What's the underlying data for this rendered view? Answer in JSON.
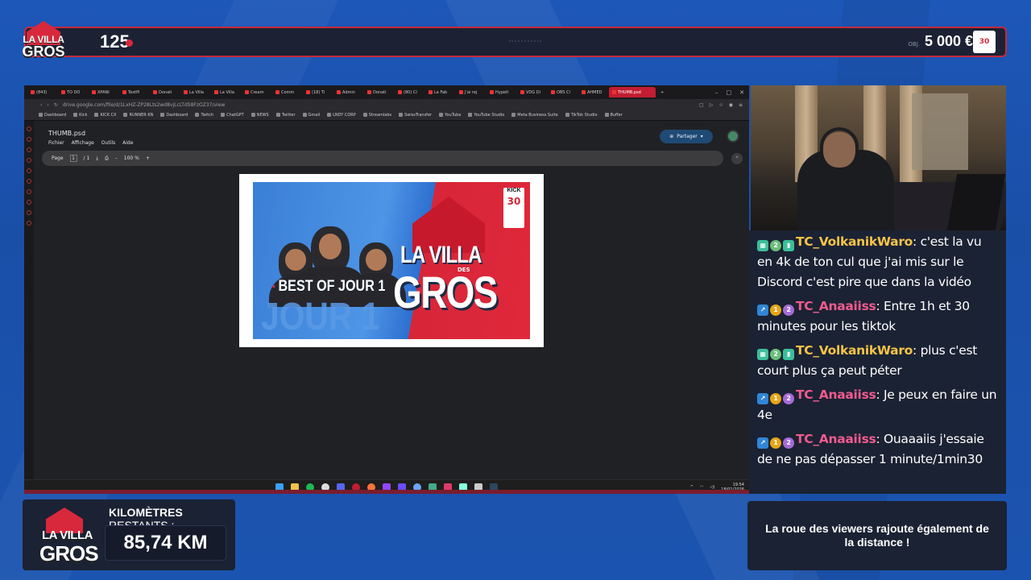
{
  "overlay": {
    "brand": {
      "line1": "LA VILLA",
      "line2": "GROS"
    },
    "top_count": "125",
    "top_obj_label": "OBJ.",
    "top_money": "5 000 €",
    "top_badge": "30",
    "km_label_bold": "KILOMÈTRES",
    "km_label_rest": "RESTANTS :",
    "km_value": "85,74 KM",
    "wheel_text": "La roue des viewers rajoute également de la distance !",
    "accent_color": "#d8283c",
    "panel_color": "#1b2233"
  },
  "browser": {
    "tabs": [
      "(843)",
      "TO DO",
      "XPANI",
      "TextPi",
      "Donati",
      "La Villa",
      "La Villa",
      "Cream",
      "Comm",
      "(18) Ti",
      "Admin",
      "Donati",
      "(80) Cl",
      "La Fab",
      "J'ai rej",
      "Hypelt",
      "VDG Di",
      "OBS Cl",
      "AHMED",
      "THUMB.psd"
    ],
    "active_tab": "THUMB.psd",
    "url": "drive.google.com/file/d/1LxHZ-ZP28Lts2wd8vjLcLTdS8FzOZ37/view",
    "bookmarks": [
      "Dashboard",
      "Kick",
      "KICK CX",
      "RUNNER KN",
      "Dashboard",
      "Twitch",
      "ChatGPT",
      "NEWS",
      "Twitter",
      "Gmail",
      "LNDY CORP",
      "Streamlabs",
      "SwissTransfer",
      "YouTube",
      "YouTube Studio",
      "Meta Business Suite",
      "TikTok Studio",
      "Buffer"
    ],
    "file_title": "THUMB.psd",
    "menu": [
      "Fichier",
      "Affichage",
      "Outils",
      "Aide"
    ],
    "share_label": "Partager",
    "page_label": "Page",
    "page_current": "1",
    "page_total": "/ 1",
    "zoom": "100 %",
    "clock_time": "19:54",
    "clock_date": "18/01/2026"
  },
  "thumbnail": {
    "best_of": "BEST OF JOUR 1",
    "jour": "JOUR 1",
    "la_villa": "LA VILLA",
    "des": "DES",
    "gros": "GROS",
    "kick": "KICK",
    "badge_num": "30"
  },
  "chat": [
    {
      "user": "TC_VolkanikWaro",
      "color": "yellow",
      "text": "c'est la vu en 4k de ton cul que j'ai mis sur le Discord c'est pire que dans la vidéo"
    },
    {
      "user": "TC_Anaaiiss",
      "color": "pink",
      "text": "Entre 1h et 30 minutes pour les tiktok"
    },
    {
      "user": "TC_VolkanikWaro",
      "color": "yellow",
      "text": "plus c'est court plus ça peut péter"
    },
    {
      "user": "TC_Anaaiiss",
      "color": "pink",
      "text": "Je peux en faire un 4e"
    },
    {
      "user": "TC_Anaaiiss",
      "color": "pink",
      "text": "Ouaaaiis j'essaie de ne pas dépasser 1 minute/1min30"
    }
  ]
}
